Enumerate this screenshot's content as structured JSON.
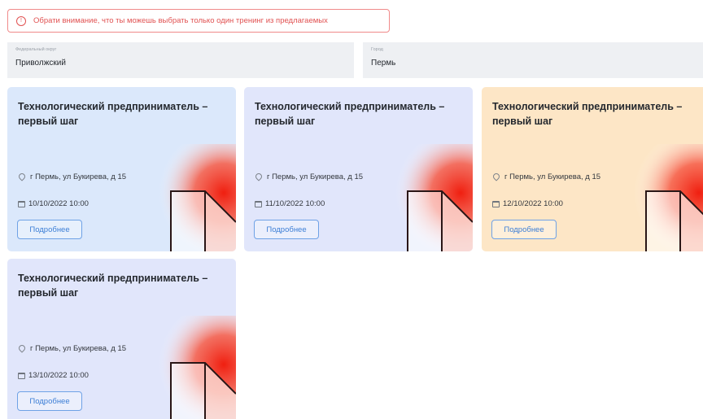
{
  "alert": {
    "text": "Обрати внимание, что ты можешь выбрать только один тренинг из предлагаемых",
    "icon": "info-circle-icon",
    "color": "#e15252"
  },
  "filters": {
    "district": {
      "label": "Федеральный округ",
      "value": "Приволжский"
    },
    "city": {
      "label": "Город",
      "value": "Пермь"
    }
  },
  "cards": [
    {
      "title": "Технологический предприниматель – первый шаг",
      "address": "г Пермь, ул Букирева, д 15",
      "date": "10/10/2022 10:00",
      "button": "Подробнее",
      "bg": "#dbe8fb"
    },
    {
      "title": "Технологический предприниматель – первый шаг",
      "address": "г Пермь, ул Букирева, д 15",
      "date": "11/10/2022 10:00",
      "button": "Подробнее",
      "bg": "#e1e6fb"
    },
    {
      "title": "Технологический предприниматель – первый шаг",
      "address": "г Пермь, ул Букирева, д 15",
      "date": "12/10/2022 10:00",
      "button": "Подробнее",
      "bg": "#fde6c6"
    },
    {
      "title": "Технологический предприниматель – первый шаг",
      "address": "г Пермь, ул Букирева, д 15",
      "date": "13/10/2022 10:00",
      "button": "Подробнее",
      "bg": "#e1e6fb"
    }
  ],
  "accent_color": "#3d7fd6"
}
